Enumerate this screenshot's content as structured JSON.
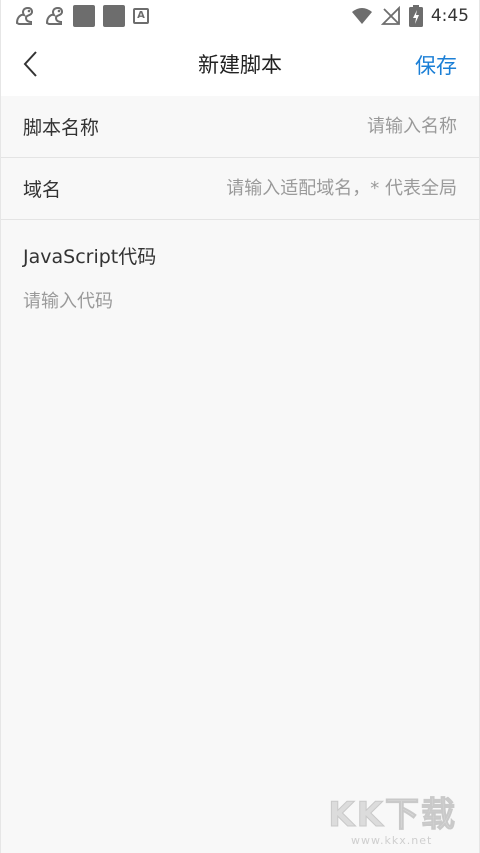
{
  "status_bar": {
    "time": "4:45",
    "left_icons": [
      "squirrel-icon",
      "squirrel-icon",
      "gray-square-icon",
      "gray-square-icon",
      "letter-a-icon"
    ],
    "letter_icon_text": "A",
    "right_icons": [
      "wifi-icon",
      "no-signal-icon",
      "battery-charging-icon"
    ]
  },
  "header": {
    "title": "新建脚本",
    "save_label": "保存",
    "back_icon": "chevron-left-icon"
  },
  "form": {
    "name_label": "脚本名称",
    "name_placeholder": "请输入名称",
    "domain_label": "域名",
    "domain_placeholder": "请输入适配域名，* 代表全局",
    "code_label": "JavaScript代码",
    "code_placeholder": "请输入代码"
  },
  "watermark": {
    "logo_chars": [
      "K",
      "K",
      "下",
      "载"
    ],
    "url": "www.kkx.net"
  },
  "colors": {
    "accent": "#1b7fd6",
    "background": "#f8f8f8",
    "header_bg": "#ffffff",
    "placeholder": "#9a9a9a",
    "divider": "#e4e4e4"
  }
}
